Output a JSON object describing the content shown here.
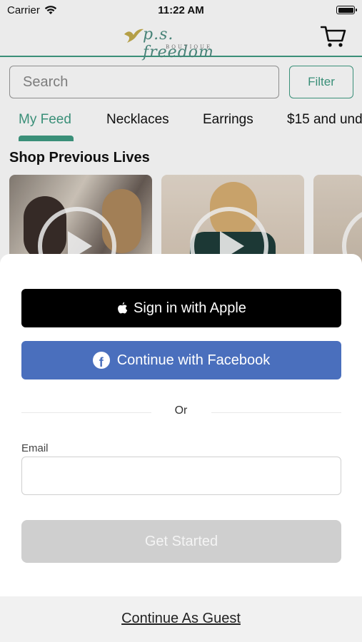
{
  "status_bar": {
    "carrier": "Carrier",
    "time": "11:22 AM"
  },
  "header": {
    "logo_text": "p.s. freedom",
    "logo_subtext": "BOUTIQUE"
  },
  "search": {
    "placeholder": "Search",
    "filter_label": "Filter"
  },
  "tabs": [
    {
      "label": "My Feed",
      "active": true
    },
    {
      "label": "Necklaces",
      "active": false
    },
    {
      "label": "Earrings",
      "active": false
    },
    {
      "label": "$15 and und",
      "active": false
    }
  ],
  "section": {
    "title": "Shop Previous Lives"
  },
  "sheet": {
    "apple_label": "Sign in with Apple",
    "facebook_label": "Continue with Facebook",
    "or_label": "Or",
    "email_label": "Email",
    "email_value": "",
    "get_started_label": "Get Started",
    "guest_label": "Continue As Guest"
  },
  "colors": {
    "accent": "#3f9c83",
    "facebook": "#4a6fbd",
    "apple": "#000000",
    "disabled": "#cfcfcf"
  }
}
